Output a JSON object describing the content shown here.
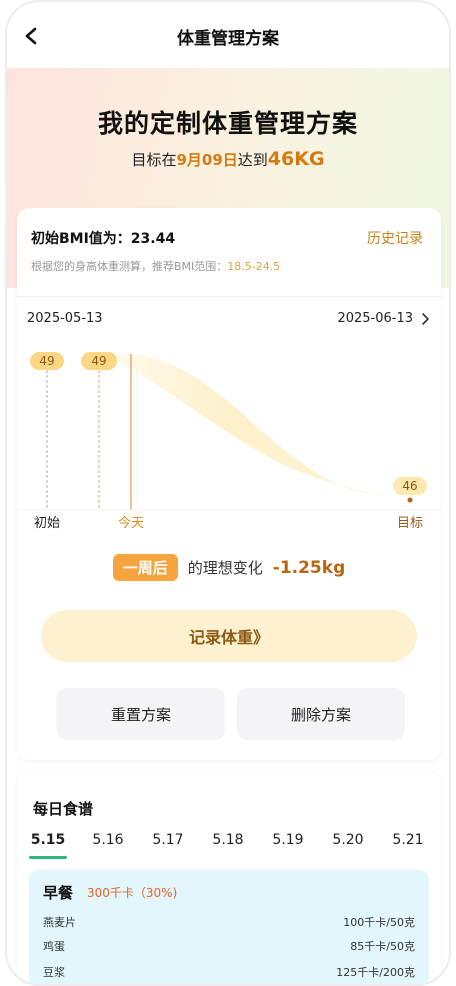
{
  "header": {
    "title": "体重管理方案",
    "back_icon": "chevron-left-icon"
  },
  "hero": {
    "title": "我的定制体重管理方案",
    "prefix": "目标在",
    "date": "9月09日",
    "middle": "达到",
    "target": "46KG"
  },
  "bmi": {
    "label": "初始BMI值为：23.44",
    "history": "历史记录",
    "note": "根据您的身高体重测算，推荐BMI范围：",
    "range": "18.5-24.5"
  },
  "chart_data": {
    "type": "area",
    "x_start": "2025-05-13",
    "x_end": "2025-06-13",
    "markers": [
      {
        "label": "初始",
        "value": "49"
      },
      {
        "label": "今天",
        "value": "49"
      },
      {
        "label": "目标",
        "value": "46"
      }
    ]
  },
  "change": {
    "badge": "一周后",
    "text": "的理想变化",
    "value": "-1.25kg"
  },
  "buttons": {
    "record": "记录体重》",
    "reset": "重置方案",
    "delete": "删除方案"
  },
  "recipe": {
    "title": "每日食谱",
    "tabs": [
      "5.15",
      "5.16",
      "5.17",
      "5.18",
      "5.19",
      "5.20",
      "5.21"
    ],
    "meal": {
      "name": "早餐",
      "kcal": "300千卡（30%)",
      "items": [
        {
          "name": "燕麦片",
          "value": "100千卡/50克"
        },
        {
          "name": "鸡蛋",
          "value": "85千卡/50克"
        },
        {
          "name": "豆浆",
          "value": "125千卡/200克"
        }
      ]
    }
  },
  "colors": {
    "accent": "#f7a440",
    "accent_dark": "#b9650f",
    "tab_active": "#2fb87a"
  }
}
